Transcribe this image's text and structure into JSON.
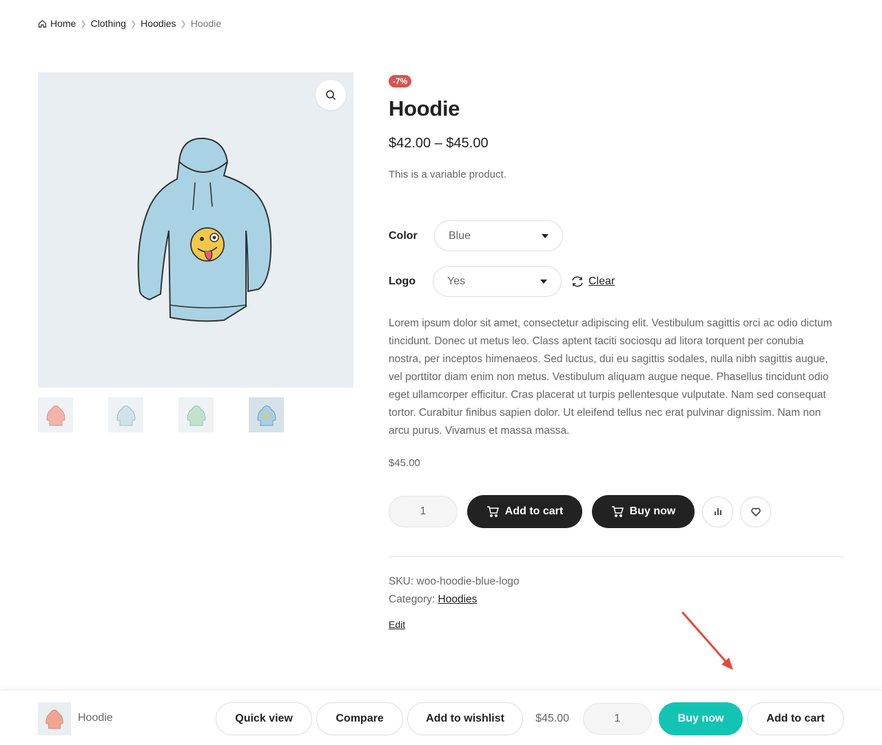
{
  "breadcrumb": {
    "home": "Home",
    "items": [
      "Clothing",
      "Hoodies"
    ],
    "current": "Hoodie"
  },
  "product": {
    "badge": "-7%",
    "title": "Hoodie",
    "price_range": "$42.00 – $45.00",
    "short_description": "This is a variable product.",
    "variations": {
      "color_label": "Color",
      "color_value": "Blue",
      "logo_label": "Logo",
      "logo_value": "Yes",
      "clear_label": "Clear"
    },
    "long_description": "Lorem ipsum dolor sit amet, consectetur adipiscing elit. Vestibulum sagittis orci ac odio dictum tincidunt. Donec ut metus leo. Class aptent taciti sociosqu ad litora torquent per conubia nostra, per inceptos himenaeos. Sed luctus, dui eu sagittis sodales, nulla nibh sagittis augue, vel porttitor diam enim non metus. Vestibulum aliquam augue neque. Phasellus tincidunt odio eget ullamcorper efficitur. Cras placerat ut turpis pellentesque vulputate. Nam sed consequat tortor. Curabitur finibus sapien dolor. Ut eleifend tellus nec erat pulvinar dignissim. Nam non arcu purus. Vivamus et massa massa.",
    "variation_price": "$45.00",
    "quantity": "1",
    "add_to_cart": "Add to cart",
    "buy_now": "Buy now",
    "sku_label": "SKU:",
    "sku": "woo-hoodie-blue-logo",
    "category_label": "Category:",
    "category": "Hoodies",
    "edit": "Edit"
  },
  "sticky_bar": {
    "name": "Hoodie",
    "quick_view": "Quick view",
    "compare": "Compare",
    "add_to_wishlist": "Add to wishlist",
    "price": "$45.00",
    "quantity": "1",
    "buy_now": "Buy now",
    "add_to_cart": "Add to cart"
  },
  "colors": {
    "buy_now_teal": "#13c4b4",
    "dark_button": "#222222",
    "badge_red": "#d9534f",
    "annotation_arrow": "#e8473b"
  },
  "icons": [
    "home-icon",
    "search-icon",
    "refresh-icon",
    "cart-icon",
    "bar-chart-icon",
    "heart-icon"
  ]
}
